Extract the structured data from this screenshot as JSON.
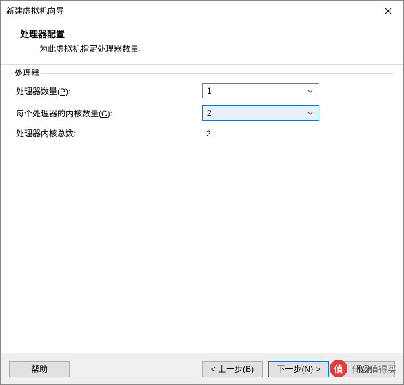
{
  "window": {
    "title": "新建虚拟机向导"
  },
  "header": {
    "title": "处理器配置",
    "subtitle": "为此虚拟机指定处理器数量。"
  },
  "group": {
    "label": "处理器"
  },
  "rows": {
    "procCount": {
      "label_pre": "处理器数量(",
      "mnemonic": "P",
      "label_post": "):",
      "value": "1"
    },
    "coresPer": {
      "label_pre": "每个处理器的内核数量(",
      "mnemonic": "C",
      "label_post": "):",
      "value": "2"
    },
    "totalCores": {
      "label": "处理器内核总数:",
      "value": "2"
    }
  },
  "buttons": {
    "help": "帮助",
    "back": "< 上一步(B)",
    "next": "下一步(N) >",
    "cancel": "取消"
  },
  "watermark": {
    "icon": "值",
    "text": "什么值得买"
  }
}
